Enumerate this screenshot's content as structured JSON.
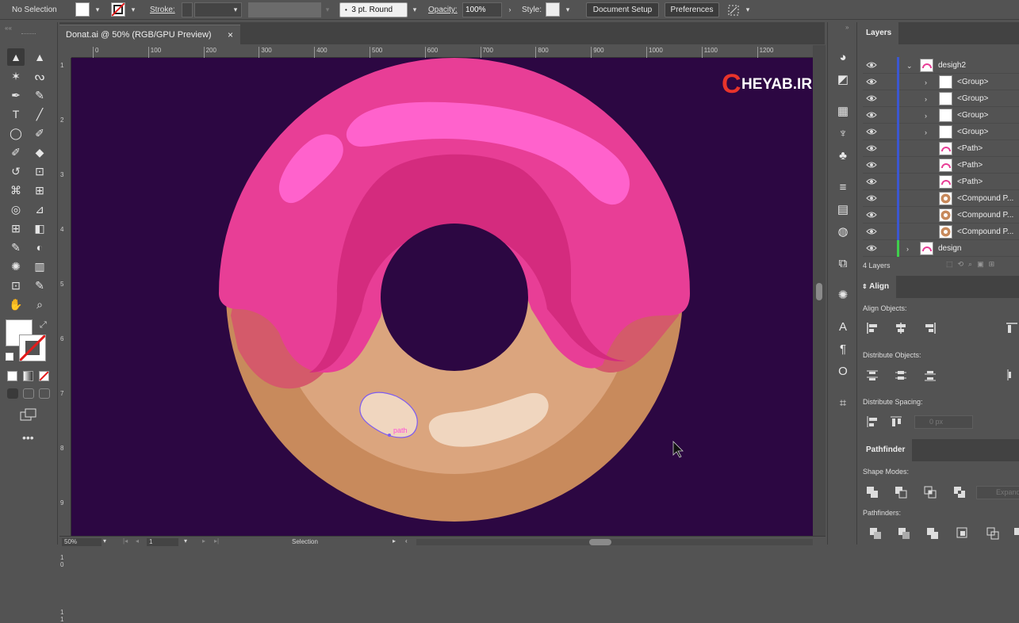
{
  "control_bar": {
    "selection_label": "No Selection",
    "stroke_label": "Stroke:",
    "brush_value": "3 pt. Round",
    "opacity_label": "Opacity:",
    "opacity_value": "100%",
    "style_label": "Style:",
    "document_setup_label": "Document Setup",
    "preferences_label": "Preferences"
  },
  "document": {
    "tab_title": "Donat.ai @ 50% (RGB/GPU Preview)",
    "close_glyph": "×"
  },
  "ruler": {
    "h_ticks": [
      "0",
      "100",
      "200",
      "300",
      "400",
      "500",
      "600",
      "700",
      "800",
      "900",
      "1000",
      "1100",
      "1200"
    ],
    "v_ticks": [
      "1",
      "2",
      "3",
      "4",
      "5",
      "6",
      "7",
      "8",
      "9",
      "1 0",
      "1 1"
    ]
  },
  "canvas": {
    "background": "#2c0742",
    "watermark_letter": "C",
    "watermark_text": "HEYAB.IR",
    "path_label": "path"
  },
  "status": {
    "zoom_value": "50%",
    "artboard_value": "1",
    "tool_name": "Selection"
  },
  "layers_panel": {
    "tab_label": "Layers",
    "rows": [
      {
        "name": "desigh2",
        "type": "layer",
        "expanded": true
      },
      {
        "name": "<Group>",
        "type": "group"
      },
      {
        "name": "<Group>",
        "type": "group"
      },
      {
        "name": "<Group>",
        "type": "group"
      },
      {
        "name": "<Group>",
        "type": "group"
      },
      {
        "name": "<Path>",
        "type": "path"
      },
      {
        "name": "<Path>",
        "type": "path"
      },
      {
        "name": "<Path>",
        "type": "path"
      },
      {
        "name": "<Compound P...",
        "type": "compound"
      },
      {
        "name": "<Compound P...",
        "type": "compound"
      },
      {
        "name": "<Compound P...",
        "type": "compound"
      },
      {
        "name": "design",
        "type": "layer",
        "expanded": false
      }
    ],
    "count_label": "4 Layers"
  },
  "align_panel": {
    "tab_label": "Align",
    "align_objects_label": "Align Objects:",
    "distribute_objects_label": "Distribute Objects:",
    "distribute_spacing_label": "Distribute Spacing:",
    "spacing_value": "0 px"
  },
  "pathfinder_panel": {
    "tab_label": "Pathfinder",
    "shape_modes_label": "Shape Modes:",
    "pathfinders_label": "Pathfinders:",
    "expand_label": "Expand"
  },
  "colors": {
    "icing": "#e83e96",
    "icing_dark": "#d42b7e",
    "icing_highlight": "#ff62cc",
    "dough": "#c88a5c",
    "dough_light": "#dba57e",
    "sprinkle": "#f0d6bf",
    "layer_bar_blue": "#3b57d1",
    "layer_bar_green": "#3fcf4c"
  }
}
